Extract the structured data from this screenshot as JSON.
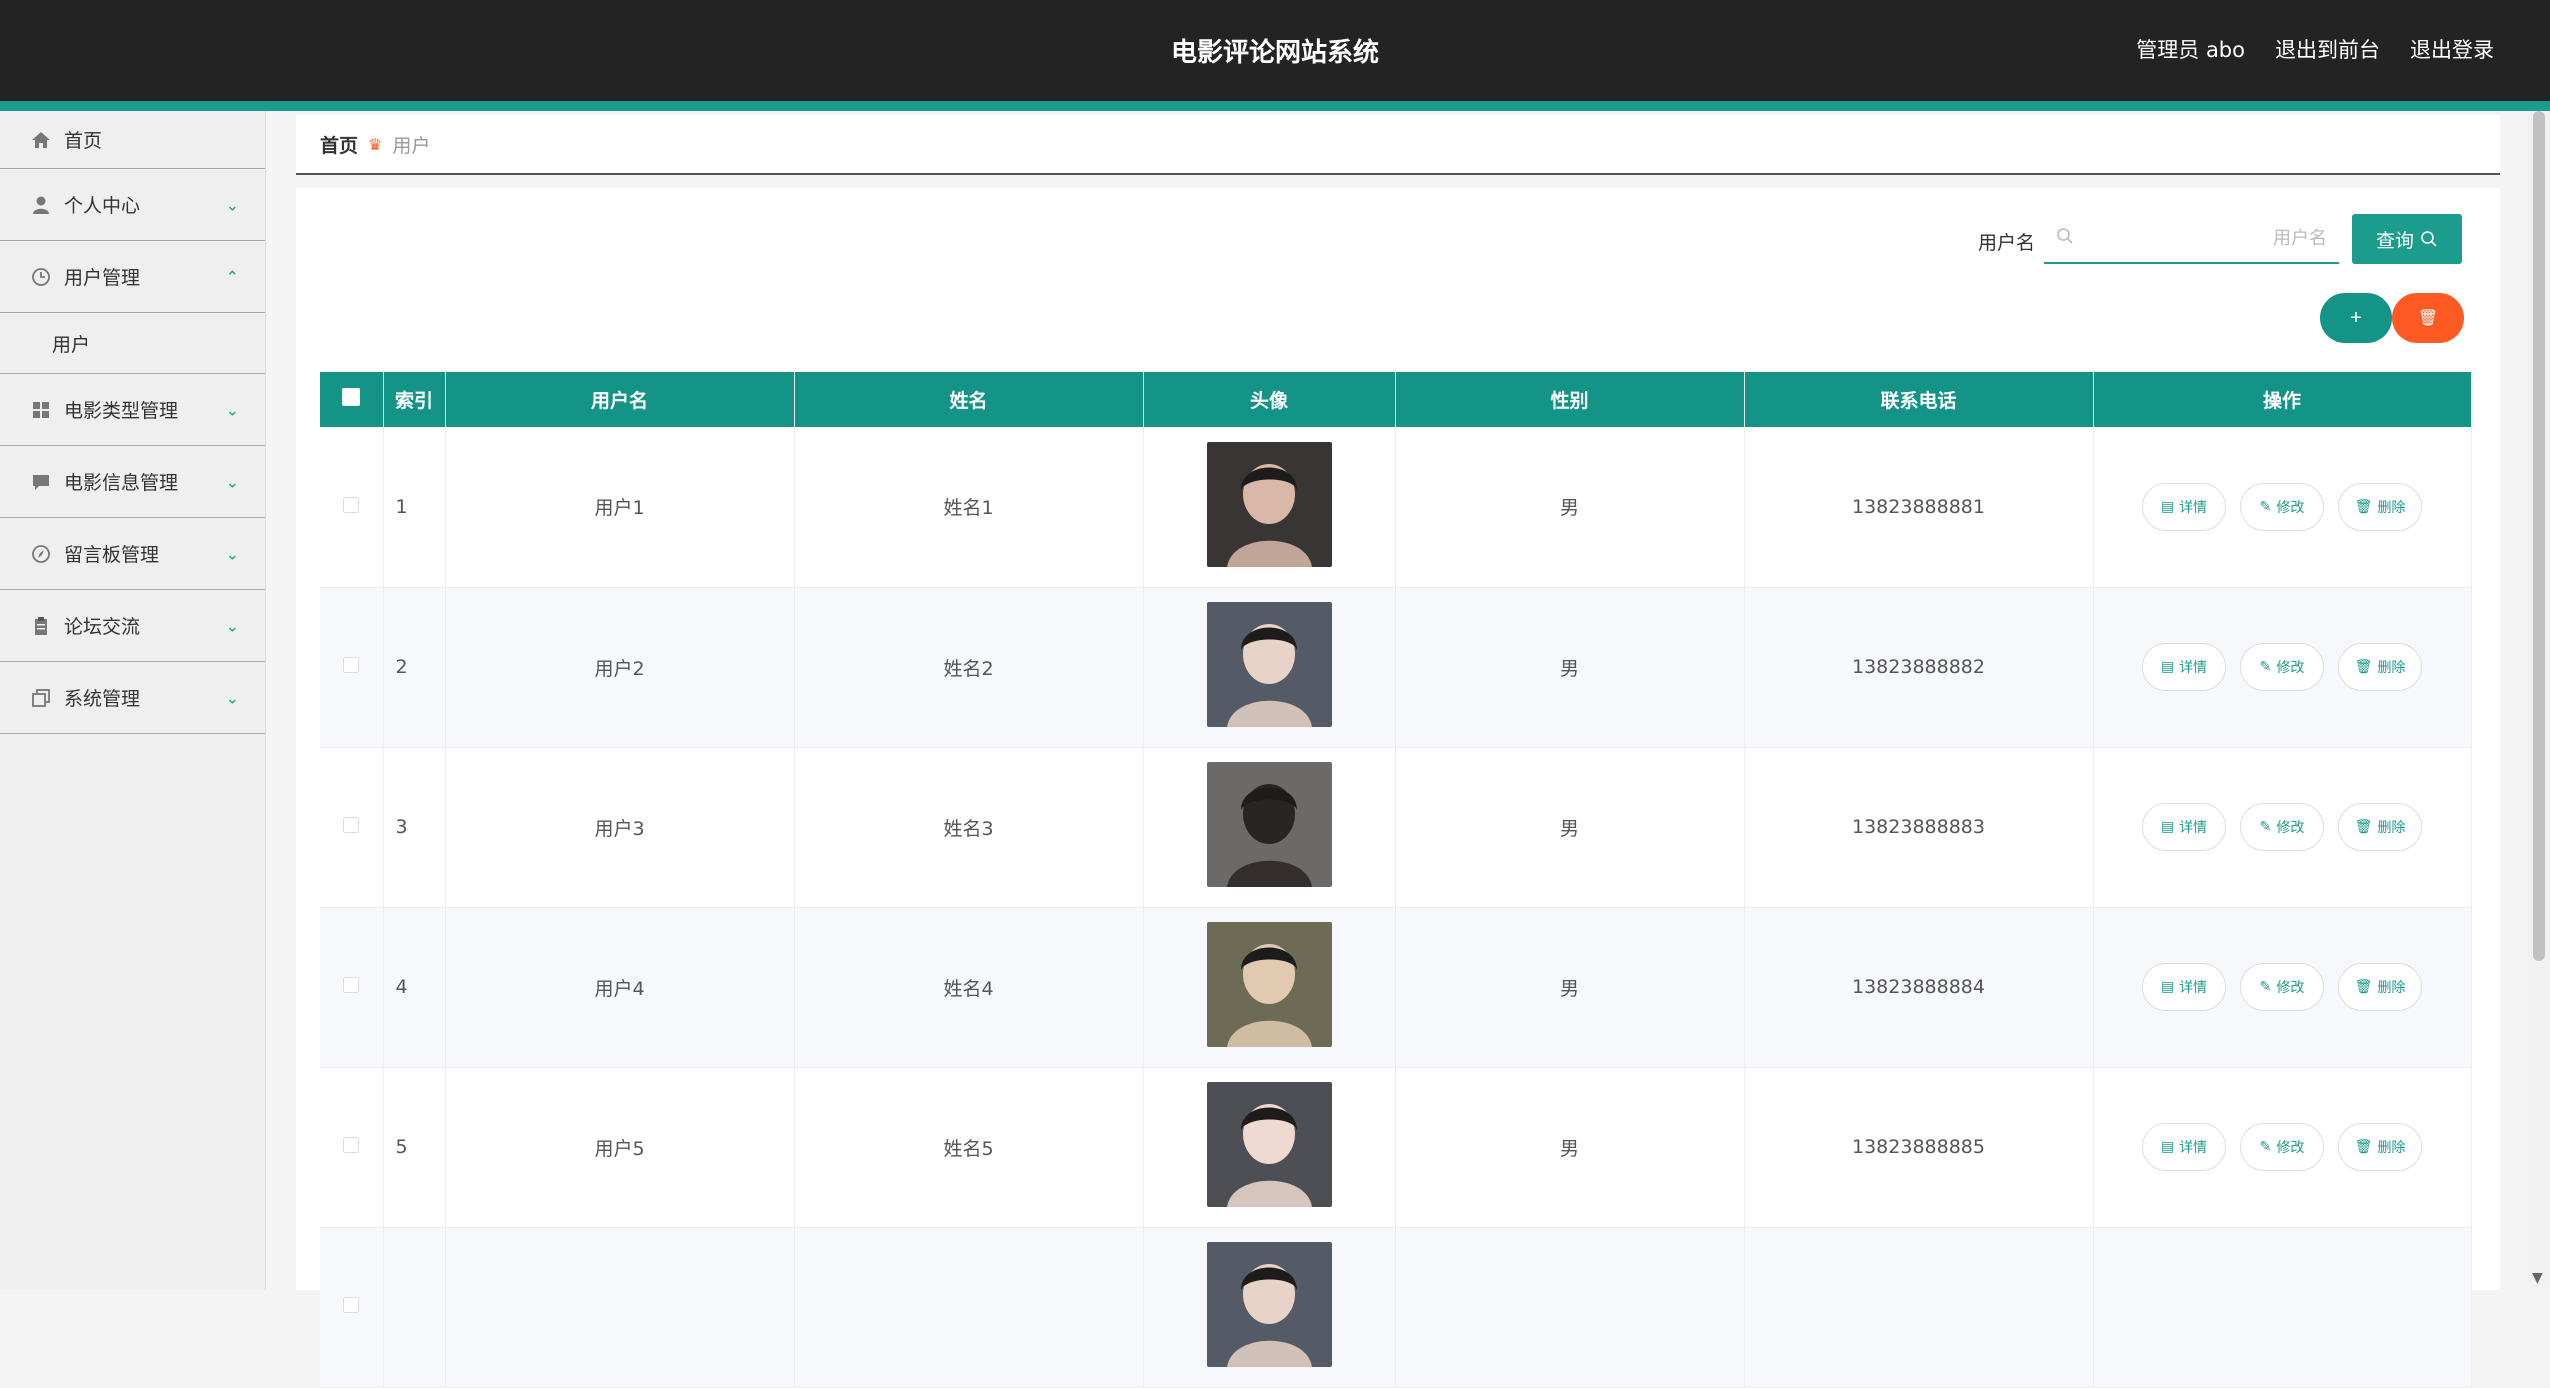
{
  "header": {
    "title": "电影评论网站系统",
    "admin_label": "管理员 abo",
    "to_front": "退出到前台",
    "logout": "退出登录"
  },
  "sidebar": {
    "items": [
      {
        "label": "首页",
        "icon": "home-icon"
      },
      {
        "label": "个人中心",
        "icon": "user-icon"
      },
      {
        "label": "用户管理",
        "icon": "clock-icon",
        "expanded": true,
        "children": [
          {
            "label": "用户"
          }
        ]
      },
      {
        "label": "电影类型管理",
        "icon": "grid-icon"
      },
      {
        "label": "电影信息管理",
        "icon": "chat-icon"
      },
      {
        "label": "留言板管理",
        "icon": "compass-icon"
      },
      {
        "label": "论坛交流",
        "icon": "clipboard-icon"
      },
      {
        "label": "系统管理",
        "icon": "copy-icon"
      }
    ]
  },
  "breadcrumb": {
    "home": "首页",
    "current": "用户"
  },
  "search": {
    "label": "用户名",
    "placeholder": "用户名",
    "button": "查询"
  },
  "toolbar": {
    "add": "+",
    "delete": "🗑"
  },
  "table": {
    "headers": [
      "",
      "索引",
      "用户名",
      "姓名",
      "头像",
      "性别",
      "联系电话",
      "操作"
    ],
    "actions": [
      "详情",
      "修改",
      "删除"
    ],
    "rows": [
      {
        "index": "1",
        "username": "用户1",
        "name": "姓名1",
        "gender": "男",
        "phone": "13823888881"
      },
      {
        "index": "2",
        "username": "用户2",
        "name": "姓名2",
        "gender": "男",
        "phone": "13823888882"
      },
      {
        "index": "3",
        "username": "用户3",
        "name": "姓名3",
        "gender": "男",
        "phone": "13823888883"
      },
      {
        "index": "4",
        "username": "用户4",
        "name": "姓名4",
        "gender": "男",
        "phone": "13823888884"
      },
      {
        "index": "5",
        "username": "用户5",
        "name": "姓名5",
        "gender": "男",
        "phone": "13823888885"
      },
      {
        "index": "",
        "username": "",
        "name": "",
        "gender": "",
        "phone": ""
      }
    ]
  },
  "colors": {
    "accent": "#139487",
    "danger": "#ff5a24",
    "topbar": "#232323"
  }
}
